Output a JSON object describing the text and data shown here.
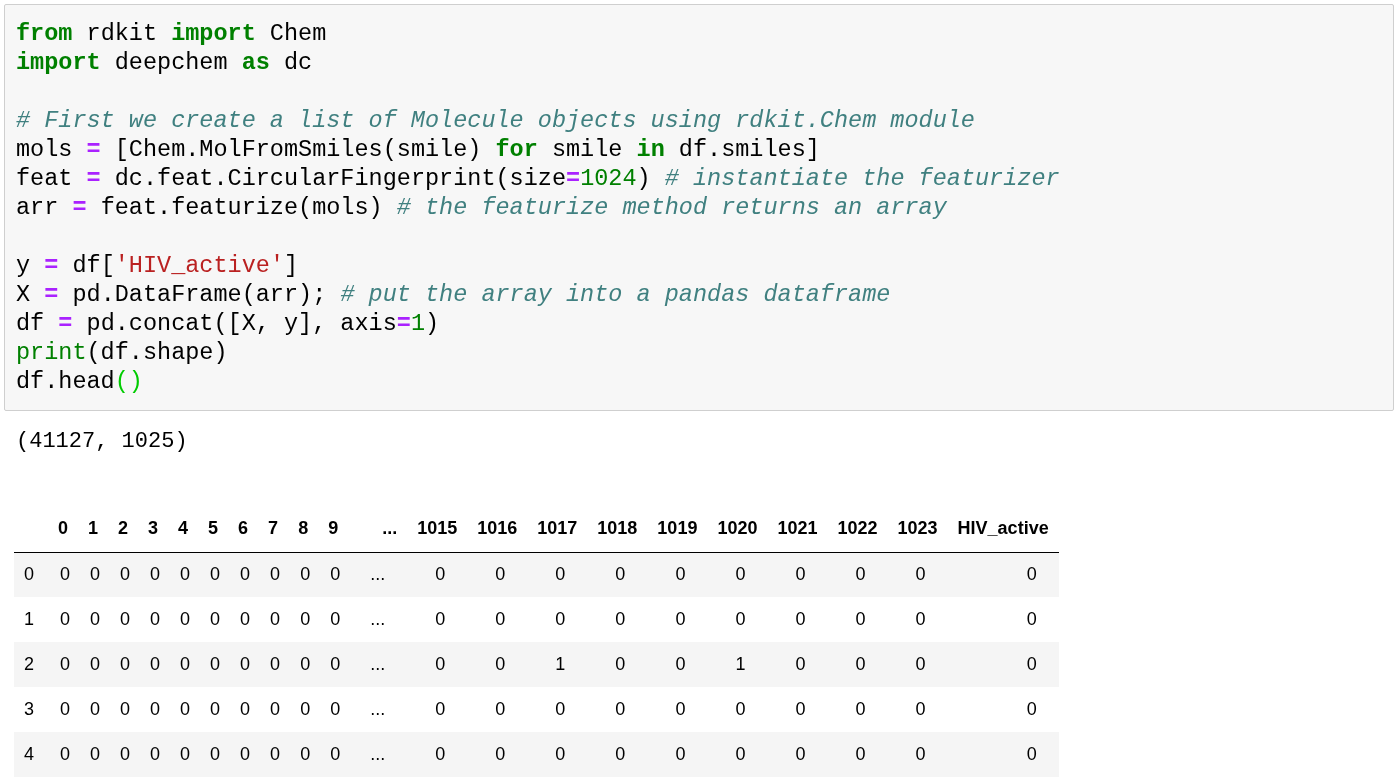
{
  "code_cell": {
    "blocks": [
      [
        {
          "tokens": [
            {
              "kind": "keyword",
              "text": "from"
            },
            {
              "kind": "name",
              "text": " rdkit "
            },
            {
              "kind": "keyword",
              "text": "import"
            },
            {
              "kind": "name",
              "text": " Chem"
            }
          ]
        },
        {
          "tokens": [
            {
              "kind": "keyword",
              "text": "import"
            },
            {
              "kind": "name",
              "text": " deepchem "
            },
            {
              "kind": "keyword",
              "text": "as"
            },
            {
              "kind": "name",
              "text": " dc"
            }
          ]
        }
      ],
      [
        {
          "tokens": [
            {
              "kind": "comment",
              "text": "# First we create a list of Molecule objects using rdkit.Chem module"
            }
          ]
        },
        {
          "tokens": [
            {
              "kind": "name",
              "text": "mols "
            },
            {
              "kind": "operator",
              "text": "="
            },
            {
              "kind": "name",
              "text": " [Chem.MolFromSmiles(smile) "
            },
            {
              "kind": "keyword",
              "text": "for"
            },
            {
              "kind": "name",
              "text": " smile "
            },
            {
              "kind": "keyword",
              "text": "in"
            },
            {
              "kind": "name",
              "text": " df.smiles]"
            }
          ]
        },
        {
          "tokens": [
            {
              "kind": "name",
              "text": "feat "
            },
            {
              "kind": "operator",
              "text": "="
            },
            {
              "kind": "name",
              "text": " dc.feat.CircularFingerprint(size"
            },
            {
              "kind": "operator",
              "text": "="
            },
            {
              "kind": "number",
              "text": "1024"
            },
            {
              "kind": "name",
              "text": ") "
            },
            {
              "kind": "comment",
              "text": "# instantiate the featurizer"
            }
          ]
        },
        {
          "tokens": [
            {
              "kind": "name",
              "text": "arr "
            },
            {
              "kind": "operator",
              "text": "="
            },
            {
              "kind": "name",
              "text": " feat.featurize(mols) "
            },
            {
              "kind": "comment",
              "text": "# the featurize method returns an array"
            }
          ]
        }
      ],
      [
        {
          "tokens": [
            {
              "kind": "name",
              "text": "y "
            },
            {
              "kind": "operator",
              "text": "="
            },
            {
              "kind": "name",
              "text": " df["
            },
            {
              "kind": "string",
              "text": "'HIV_active'"
            },
            {
              "kind": "name",
              "text": "]"
            }
          ]
        },
        {
          "tokens": [
            {
              "kind": "name",
              "text": "X "
            },
            {
              "kind": "operator",
              "text": "="
            },
            {
              "kind": "name",
              "text": " pd.DataFrame(arr); "
            },
            {
              "kind": "comment",
              "text": "# put the array into a pandas dataframe"
            }
          ]
        },
        {
          "tokens": [
            {
              "kind": "name",
              "text": "df "
            },
            {
              "kind": "operator",
              "text": "="
            },
            {
              "kind": "name",
              "text": " pd.concat([X, y], axis"
            },
            {
              "kind": "operator",
              "text": "="
            },
            {
              "kind": "number",
              "text": "1"
            },
            {
              "kind": "name",
              "text": ")"
            }
          ]
        },
        {
          "tokens": [
            {
              "kind": "builtin",
              "text": "print"
            },
            {
              "kind": "name",
              "text": "(df.shape)"
            }
          ]
        },
        {
          "tokens": [
            {
              "kind": "name",
              "text": "df.head"
            },
            {
              "kind": "bracket",
              "text": "()"
            }
          ]
        }
      ]
    ]
  },
  "output_text": "(41127, 1025)",
  "table": {
    "columns": [
      "0",
      "1",
      "2",
      "3",
      "4",
      "5",
      "6",
      "7",
      "8",
      "9",
      "...",
      "1015",
      "1016",
      "1017",
      "1018",
      "1019",
      "1020",
      "1021",
      "1022",
      "1023",
      "HIV_active"
    ],
    "rows": [
      {
        "index": "0",
        "cells": [
          "0",
          "0",
          "0",
          "0",
          "0",
          "0",
          "0",
          "0",
          "0",
          "0",
          "...",
          "0",
          "0",
          "0",
          "0",
          "0",
          "0",
          "0",
          "0",
          "0",
          "0"
        ]
      },
      {
        "index": "1",
        "cells": [
          "0",
          "0",
          "0",
          "0",
          "0",
          "0",
          "0",
          "0",
          "0",
          "0",
          "...",
          "0",
          "0",
          "0",
          "0",
          "0",
          "0",
          "0",
          "0",
          "0",
          "0"
        ]
      },
      {
        "index": "2",
        "cells": [
          "0",
          "0",
          "0",
          "0",
          "0",
          "0",
          "0",
          "0",
          "0",
          "0",
          "...",
          "0",
          "0",
          "1",
          "0",
          "0",
          "1",
          "0",
          "0",
          "0",
          "0"
        ]
      },
      {
        "index": "3",
        "cells": [
          "0",
          "0",
          "0",
          "0",
          "0",
          "0",
          "0",
          "0",
          "0",
          "0",
          "...",
          "0",
          "0",
          "0",
          "0",
          "0",
          "0",
          "0",
          "0",
          "0",
          "0"
        ]
      },
      {
        "index": "4",
        "cells": [
          "0",
          "0",
          "0",
          "0",
          "0",
          "0",
          "0",
          "0",
          "0",
          "0",
          "...",
          "0",
          "0",
          "0",
          "0",
          "0",
          "0",
          "0",
          "0",
          "0",
          "0"
        ]
      }
    ]
  }
}
